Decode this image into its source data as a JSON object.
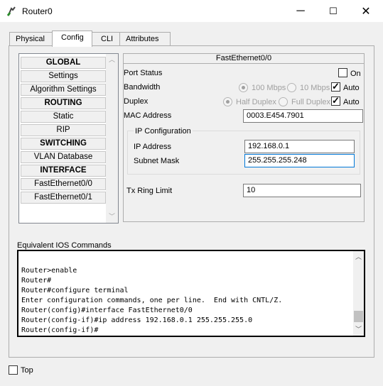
{
  "window": {
    "title": "Router0",
    "minimize": "─",
    "maximize": "☐",
    "close": "✕"
  },
  "tabs": [
    {
      "label": "Physical"
    },
    {
      "label": "Config",
      "active": true
    },
    {
      "label": "CLI"
    },
    {
      "label": "Attributes"
    }
  ],
  "sidebar": {
    "items": [
      {
        "label": "GLOBAL",
        "header": true
      },
      {
        "label": "Settings"
      },
      {
        "label": "Algorithm Settings"
      },
      {
        "label": "ROUTING",
        "header": true
      },
      {
        "label": "Static"
      },
      {
        "label": "RIP"
      },
      {
        "label": "SWITCHING",
        "header": true
      },
      {
        "label": "VLAN Database"
      },
      {
        "label": "INTERFACE",
        "header": true
      },
      {
        "label": "FastEthernet0/0"
      },
      {
        "label": "FastEthernet0/1"
      }
    ]
  },
  "interface": {
    "title": "FastEthernet0/0",
    "port_status": {
      "label": "Port Status",
      "on_label": "On",
      "on": false
    },
    "bandwidth": {
      "label": "Bandwidth",
      "opt1": "100 Mbps",
      "opt2": "10 Mbps",
      "auto_label": "Auto",
      "auto": true
    },
    "duplex": {
      "label": "Duplex",
      "opt1": "Half Duplex",
      "opt2": "Full Duplex",
      "auto_label": "Auto",
      "auto": true
    },
    "mac": {
      "label": "MAC Address",
      "value": "0003.E454.7901"
    },
    "ip_config": {
      "title": "IP Configuration",
      "ip_label": "IP Address",
      "ip_value": "192.168.0.1",
      "mask_label": "Subnet Mask",
      "mask_value": "255.255.255.248"
    },
    "tx_ring": {
      "label": "Tx Ring Limit",
      "value": "10"
    }
  },
  "console": {
    "label": "Equivalent IOS Commands",
    "lines": [
      "Router>enable",
      "Router#",
      "Router#configure terminal",
      "Enter configuration commands, one per line.  End with CNTL/Z.",
      "Router(config)#interface FastEthernet0/0",
      "Router(config-if)#ip address 192.168.0.1 255.255.255.0",
      "Router(config-if)#"
    ]
  },
  "footer": {
    "top_label": "Top",
    "top_checked": false
  },
  "colors": {
    "accent": "#0078d7"
  }
}
